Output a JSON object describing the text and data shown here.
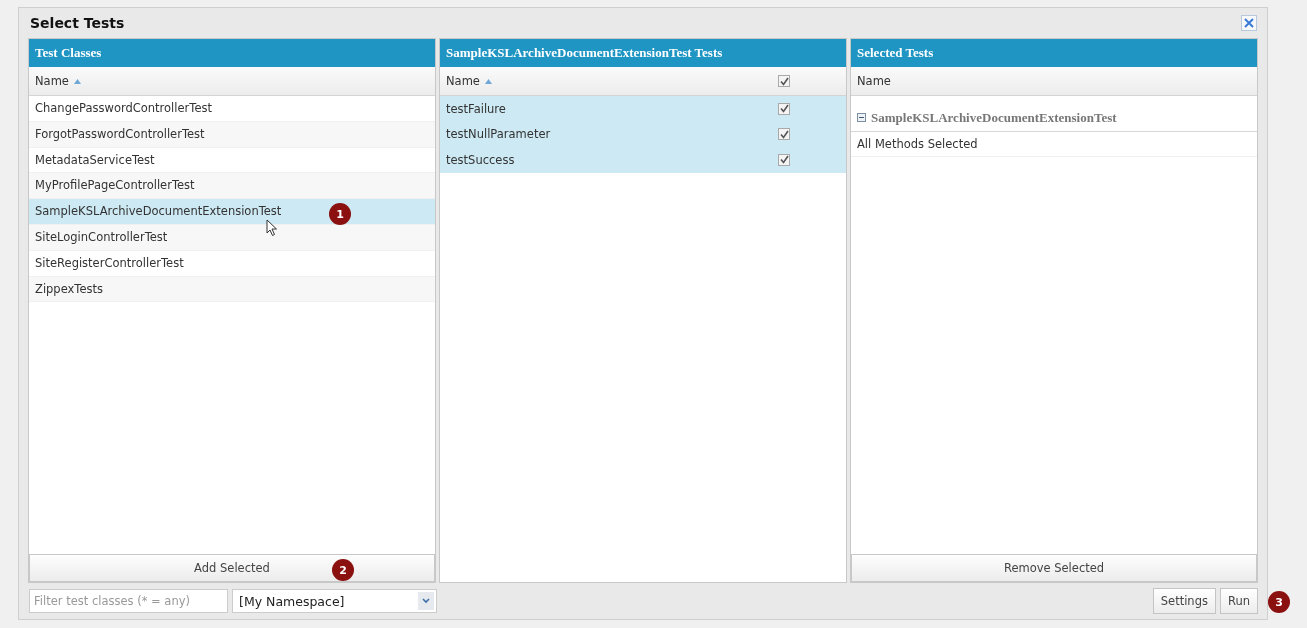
{
  "window": {
    "title": "Select Tests"
  },
  "test_classes": {
    "title": "Test Classes",
    "column": "Name",
    "rows": [
      {
        "name": "ChangePasswordControllerTest",
        "selected": false
      },
      {
        "name": "ForgotPasswordControllerTest",
        "selected": false
      },
      {
        "name": "MetadataServiceTest",
        "selected": false
      },
      {
        "name": "MyProfilePageControllerTest",
        "selected": false
      },
      {
        "name": "SampleKSLArchiveDocumentExtensionTest",
        "selected": true
      },
      {
        "name": "SiteLoginControllerTest",
        "selected": false
      },
      {
        "name": "SiteRegisterControllerTest",
        "selected": false
      },
      {
        "name": "ZippexTests",
        "selected": false
      }
    ],
    "button": "Add Selected"
  },
  "methods": {
    "title": "SampleKSLArchiveDocumentExtensionTest Tests",
    "column": "Name",
    "all_checked": true,
    "rows": [
      {
        "name": "testFailure",
        "checked": true,
        "selected": true
      },
      {
        "name": "testNullParameter",
        "checked": true,
        "selected": true
      },
      {
        "name": "testSuccess",
        "checked": true,
        "selected": true
      }
    ]
  },
  "selected_tests": {
    "title": "Selected Tests",
    "column": "Name",
    "groups": [
      {
        "name": "SampleKSLArchiveDocumentExtensionTest",
        "expanded": true,
        "summary": "All Methods Selected"
      }
    ],
    "button": "Remove Selected"
  },
  "toolbar": {
    "filter": {
      "placeholder": "Filter test classes (* = any)"
    },
    "namespace": {
      "value": "[My Namespace]"
    },
    "buttons": [
      "Settings",
      "Run"
    ]
  },
  "callouts": [
    "1",
    "2",
    "3"
  ]
}
